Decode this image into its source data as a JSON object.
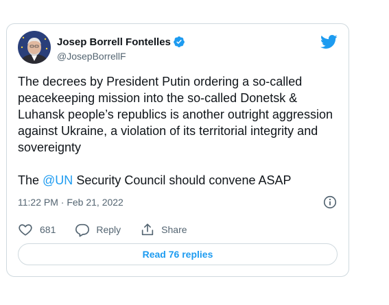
{
  "author": {
    "name": "Josep Borrell Fontelles",
    "handle": "@JosepBorrellF",
    "verified": true,
    "avatar_icon": "profile-photo"
  },
  "brand": {
    "icon": "twitter-bird-icon",
    "color": "#1d9bf0"
  },
  "tweet": {
    "line1": "The decrees by President Putin ordering a so-called peacekeeping mission into the so-called Donetsk & Luhansk people’s republics is another outright aggression against Ukraine, a  violation of its territorial integrity and sovereignty",
    "line2_prefix": "The ",
    "mention": "@UN",
    "line2_suffix": " Security Council should convene ASAP",
    "timestamp": "11:22 PM · Feb 21, 2022"
  },
  "actions": {
    "like_count": "681",
    "reply_label": "Reply",
    "share_label": "Share"
  },
  "read_replies_label": "Read 76 replies",
  "colors": {
    "text": "#0f1419",
    "secondary": "#536471",
    "accent": "#1d9bf0",
    "border": "#cfd9de"
  }
}
